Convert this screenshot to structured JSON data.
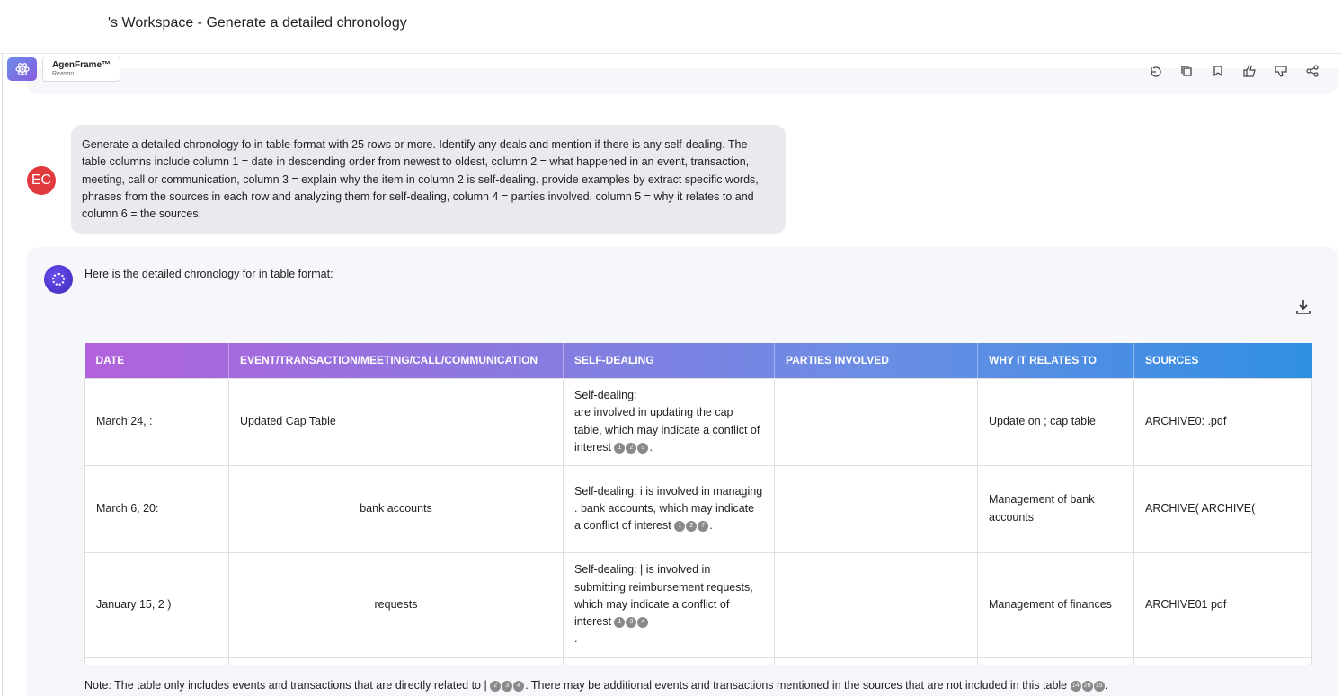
{
  "header": {
    "title": "'s Workspace  -  Generate a detailed chronology"
  },
  "model": {
    "name": "AgenFrame™",
    "mode": "Reason"
  },
  "user": {
    "initials": "EC",
    "message": "Generate a detailed chronology fo         in table format with 25 rows or more. Identify any deals and mention if there is any self-dealing. The table columns include column 1 = date in descending order from newest to oldest, column 2 = what happened in an event, transaction, meeting, call or communication, column 3 = explain why the item in column 2 is self-dealing. provide examples by extract specific words, phrases from the sources in each row and analyzing them for self-dealing, column 4 = parties involved, column 5 = why it relates to         and column 6 = the sources."
  },
  "assistant": {
    "intro": "Here is the detailed chronology for        in table format:",
    "note_prefix": "Note: The table only includes events and transactions that are directly related to       |",
    "note_citations": [
      "2",
      "3",
      "4"
    ],
    "note_middle": ". There may be additional events and transactions mentioned in the sources that are not included in this table",
    "note_citations2": [
      "14",
      "28",
      "15"
    ],
    "note_suffix": "."
  },
  "table": {
    "headers": [
      "DATE",
      "EVENT/TRANSACTION/MEETING/CALL/COMMUNICATION",
      "SELF-DEALING",
      "PARTIES INVOLVED",
      "WHY IT RELATES TO",
      "SOURCES"
    ],
    "rows": [
      {
        "date": "March 24, :",
        "event": "Updated Cap Table",
        "self_label": "Self-dealing:",
        "self_text": "are involved in updating the cap table, which may indicate a conflict of interest",
        "self_cites": [
          "1",
          "2",
          "3"
        ],
        "parties": "",
        "why": "Update on        ; cap table",
        "sources": "ARCHIVE0:            .pdf"
      },
      {
        "date": "March 6, 20:",
        "event": "bank accounts",
        "self_label": "Self-dealing:",
        "self_text": "                         i is involved in managing                    .   bank accounts, which may indicate a conflict of interest",
        "self_cites": [
          "1",
          "2",
          "7"
        ],
        "parties": "",
        "why": "Management of                bank accounts",
        "sources": "ARCHIVE(                ARCHIVE("
      },
      {
        "date": "January 15, 2   )",
        "event": "requests",
        "self_label": "Self-dealing:",
        "self_text": "                              | is involved in submitting reimbursement requests, which may indicate a conflict of interest",
        "self_cites": [
          "1",
          "3",
          "4"
        ],
        "parties": "",
        "why": "Management of finances",
        "sources": "ARCHIVE01           pdf"
      }
    ]
  },
  "colors": {
    "header_gradient_start": "#b262dc",
    "header_gradient_end": "#2f8fe3",
    "user_avatar": "#e0393e"
  },
  "icons": [
    "atom-logo-icon",
    "copy-icon",
    "bookmark-icon",
    "thumbs-up-icon",
    "thumbs-down-icon",
    "share-icon",
    "download-icon"
  ]
}
